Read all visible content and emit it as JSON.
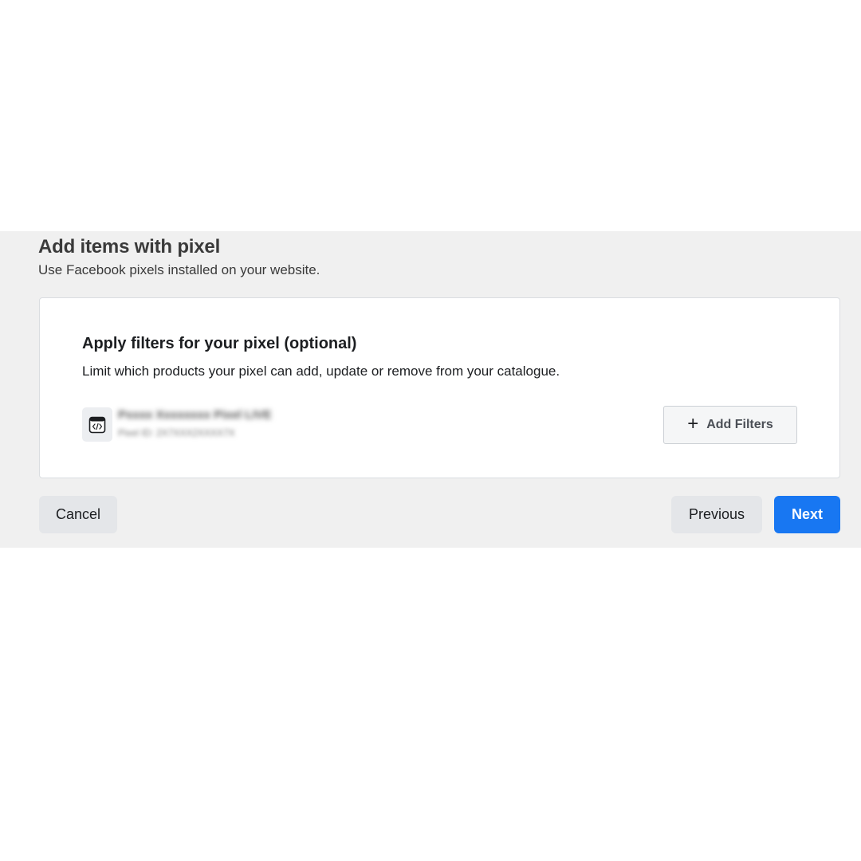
{
  "header": {
    "title": "Add items with pixel",
    "subtitle": "Use Facebook pixels installed on your website."
  },
  "card": {
    "title": "Apply filters for your pixel (optional)",
    "description": "Limit which products your pixel can add, update or remove from your catalogue.",
    "pixel": {
      "icon": "code-icon",
      "name": "Pxxxx Xxxxxxxx Pixel LIVE",
      "id": "Pixel ID: 2X7XXX2XXXX7X"
    },
    "add_filters_label": "Add Filters"
  },
  "footer": {
    "cancel_label": "Cancel",
    "previous_label": "Previous",
    "next_label": "Next"
  },
  "colors": {
    "band_bg": "#f0f0f0",
    "primary": "#1877f2",
    "secondary_btn": "#e4e6e9"
  }
}
